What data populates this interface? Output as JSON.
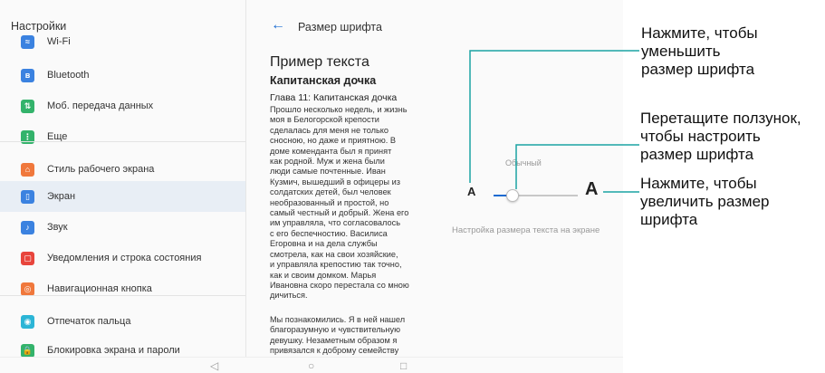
{
  "left_pane": {
    "title": "Настройки",
    "items": [
      {
        "label": "Wi-Fi",
        "icon": "wifi-icon",
        "color": "#3b82e0",
        "glyph": "≈"
      },
      {
        "label": "Bluetooth",
        "icon": "bluetooth-icon",
        "color": "#3b82e0",
        "glyph": "ʙ"
      },
      {
        "label": "Моб. передача данных",
        "icon": "mobile-data-icon",
        "color": "#33b36b",
        "glyph": "⇅"
      },
      {
        "label": "Еще",
        "icon": "more-icon",
        "color": "#33b36b",
        "glyph": "⋮"
      },
      {
        "label": "Стиль рабочего экрана",
        "icon": "home-style-icon",
        "color": "#f0783c",
        "glyph": "⌂"
      },
      {
        "label": "Экран",
        "icon": "display-icon",
        "color": "#3b82e0",
        "glyph": "▯"
      },
      {
        "label": "Звук",
        "icon": "sound-icon",
        "color": "#3b82e0",
        "glyph": "♪"
      },
      {
        "label": "Уведомления и строка состояния",
        "icon": "notifications-icon",
        "color": "#e8453c",
        "glyph": "▢"
      },
      {
        "label": "Навигационная кнопка",
        "icon": "navigation-button-icon",
        "color": "#f0783c",
        "glyph": "◎"
      },
      {
        "label": "Отпечаток пальца",
        "icon": "fingerprint-icon",
        "color": "#2bb5d6",
        "glyph": "◉"
      },
      {
        "label": "Блокировка экрана и пароли",
        "icon": "lock-icon",
        "color": "#33b36b",
        "glyph": "🔒"
      }
    ],
    "selected_index": 5
  },
  "right_pane": {
    "title": "Размер шрифта",
    "sample_heading": "Пример текста",
    "sample_subheading": "Капитанская дочка",
    "chapter_title": "Глава 11: Капитанская дочка",
    "paragraph1": "Прошло несколько недель, и жизнь\nмоя в Белогорской крепости\nсделалась для меня не только\nсносною, но даже и приятною. В\nдоме коменданта был я принят\nкак родной. Муж и жена были\nлюди самые почтенные. Иван\nКузмич, вышедший в офицеры из\nсолдатских детей, был человек\nнеобразованный и простой, но\nсамый честный и добрый. Жена его\nим управляла, что согласовалось\nс его беспечностию. Василиса\nЕгоровна и на дела службы\nсмотрела, как на свои хозяйские,\nи управляла крепостию так точно,\nкак и своим домком. Марья\nИвановна скоро перестала со мною\nдичиться.",
    "paragraph2": "Мы познакомились. Я в ней нашел\nблагоразумную и чувствительную\nдевушку. Незаметным образом я\nпривязался к доброму семейству",
    "slider": {
      "current_label": "Обычный",
      "small_a": "A",
      "large_a": "A",
      "value_fraction": 0.23
    },
    "hint": "Настройка размера текста на экране"
  },
  "nav_bar": {
    "back_glyph": "◁",
    "home_glyph": "○",
    "recents_glyph": "□"
  },
  "callouts": {
    "decrease": "Нажмите, чтобы\nуменьшить\nразмер шрифта",
    "drag": "Перетащите ползунок,\nчтобы настроить\nразмер шрифта",
    "increase": "Нажмите, чтобы\nувеличить размер\nшрифта"
  },
  "colors": {
    "accent": "#1a6bd1",
    "leader_line": "#1aa3a3",
    "selected_bg": "#e8eef5"
  }
}
